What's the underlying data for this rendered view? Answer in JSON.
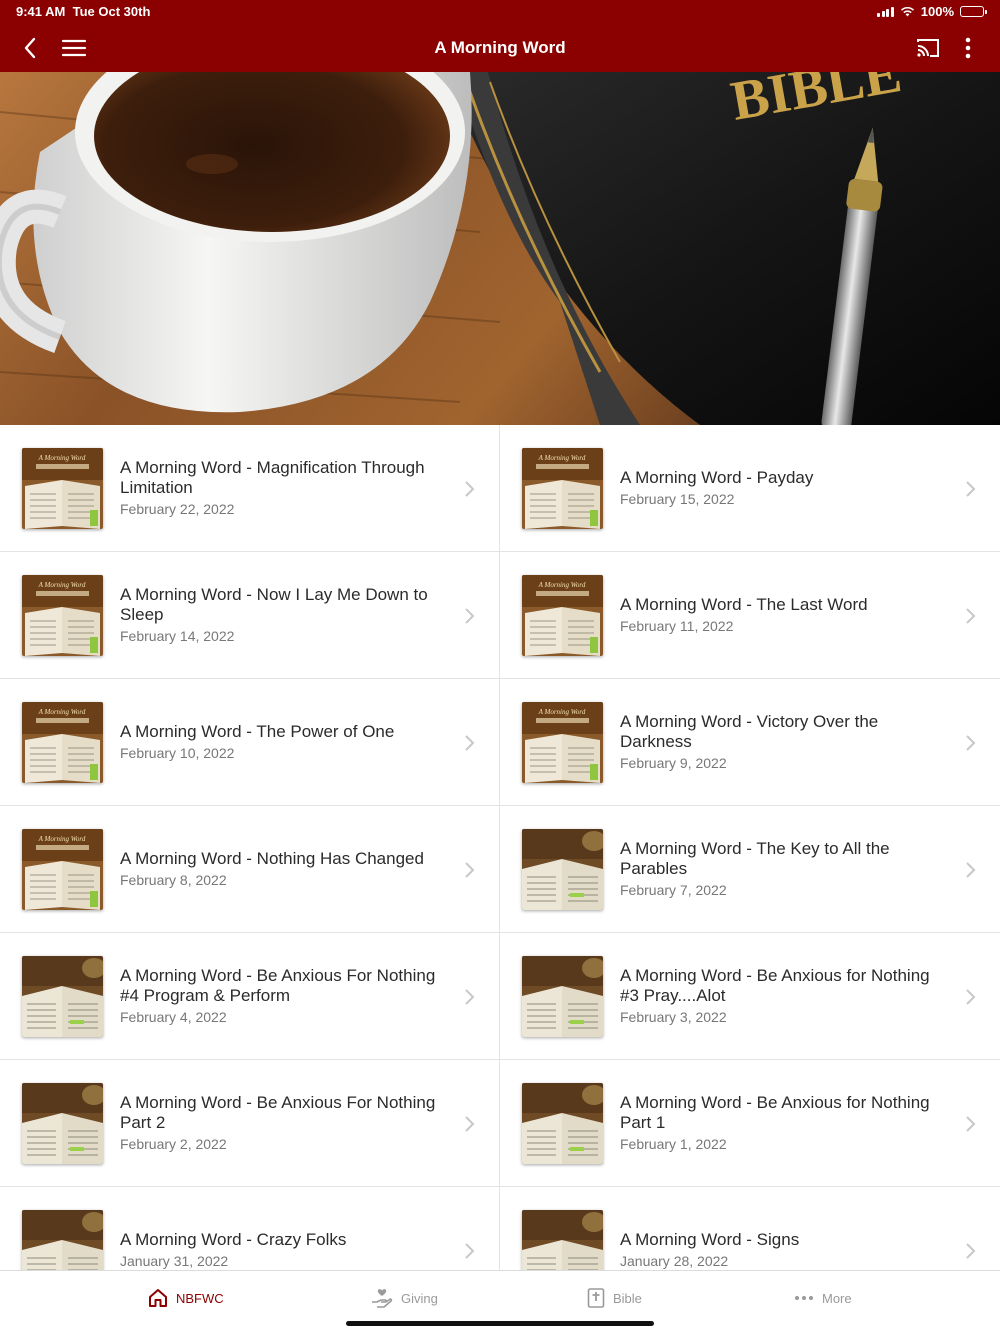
{
  "status_bar": {
    "time": "9:41 AM",
    "date": "Tue Oct 30th",
    "battery": "100%"
  },
  "header": {
    "title": "A Morning Word"
  },
  "items": [
    {
      "title": "A Morning Word - Magnification Through Limitation",
      "date": "February 22, 2022",
      "thumb": "book"
    },
    {
      "title": "A Morning Word - Payday",
      "date": "February 15, 2022",
      "thumb": "book"
    },
    {
      "title": "A Morning Word - Now I Lay Me Down to Sleep",
      "date": "February 14, 2022",
      "thumb": "book"
    },
    {
      "title": "A Morning Word - The Last Word",
      "date": "February 11, 2022",
      "thumb": "book"
    },
    {
      "title": "A Morning Word - The Power of One",
      "date": "February 10, 2022",
      "thumb": "book"
    },
    {
      "title": "A Morning Word - Victory Over the Darkness",
      "date": "February 9, 2022",
      "thumb": "book"
    },
    {
      "title": "A Morning Word - Nothing Has Changed",
      "date": "February 8, 2022",
      "thumb": "book"
    },
    {
      "title": "A Morning Word - The Key to All the Parables",
      "date": "February 7, 2022",
      "thumb": "desk"
    },
    {
      "title": "A Morning Word - Be Anxious For Nothing #4 Program & Perform",
      "date": "February 4, 2022",
      "thumb": "desk"
    },
    {
      "title": "A Morning Word - Be Anxious for Nothing #3  Pray....Alot",
      "date": "February 3, 2022",
      "thumb": "desk"
    },
    {
      "title": "A Morning Word - Be Anxious For Nothing Part 2",
      "date": "February 2, 2022",
      "thumb": "desk"
    },
    {
      "title": "A Morning Word - Be Anxious for Nothing Part 1",
      "date": "February 1, 2022",
      "thumb": "desk"
    },
    {
      "title": "A Morning Word - Crazy Folks",
      "date": "January 31, 2022",
      "thumb": "desk"
    },
    {
      "title": "A Morning Word - Signs",
      "date": "January 28, 2022",
      "thumb": "desk"
    }
  ],
  "tabs": [
    {
      "label": "NBFWC",
      "icon": "home-icon",
      "active": true
    },
    {
      "label": "Giving",
      "icon": "giving-icon",
      "active": false
    },
    {
      "label": "Bible",
      "icon": "bible-icon",
      "active": false
    },
    {
      "label": "More",
      "icon": "more-dots-icon",
      "active": false
    }
  ],
  "colors": {
    "brand": "#8b0000",
    "chevron": "#c7c7cc",
    "divider": "#e3e3e3",
    "tab_inactive": "#9a9a9a"
  }
}
